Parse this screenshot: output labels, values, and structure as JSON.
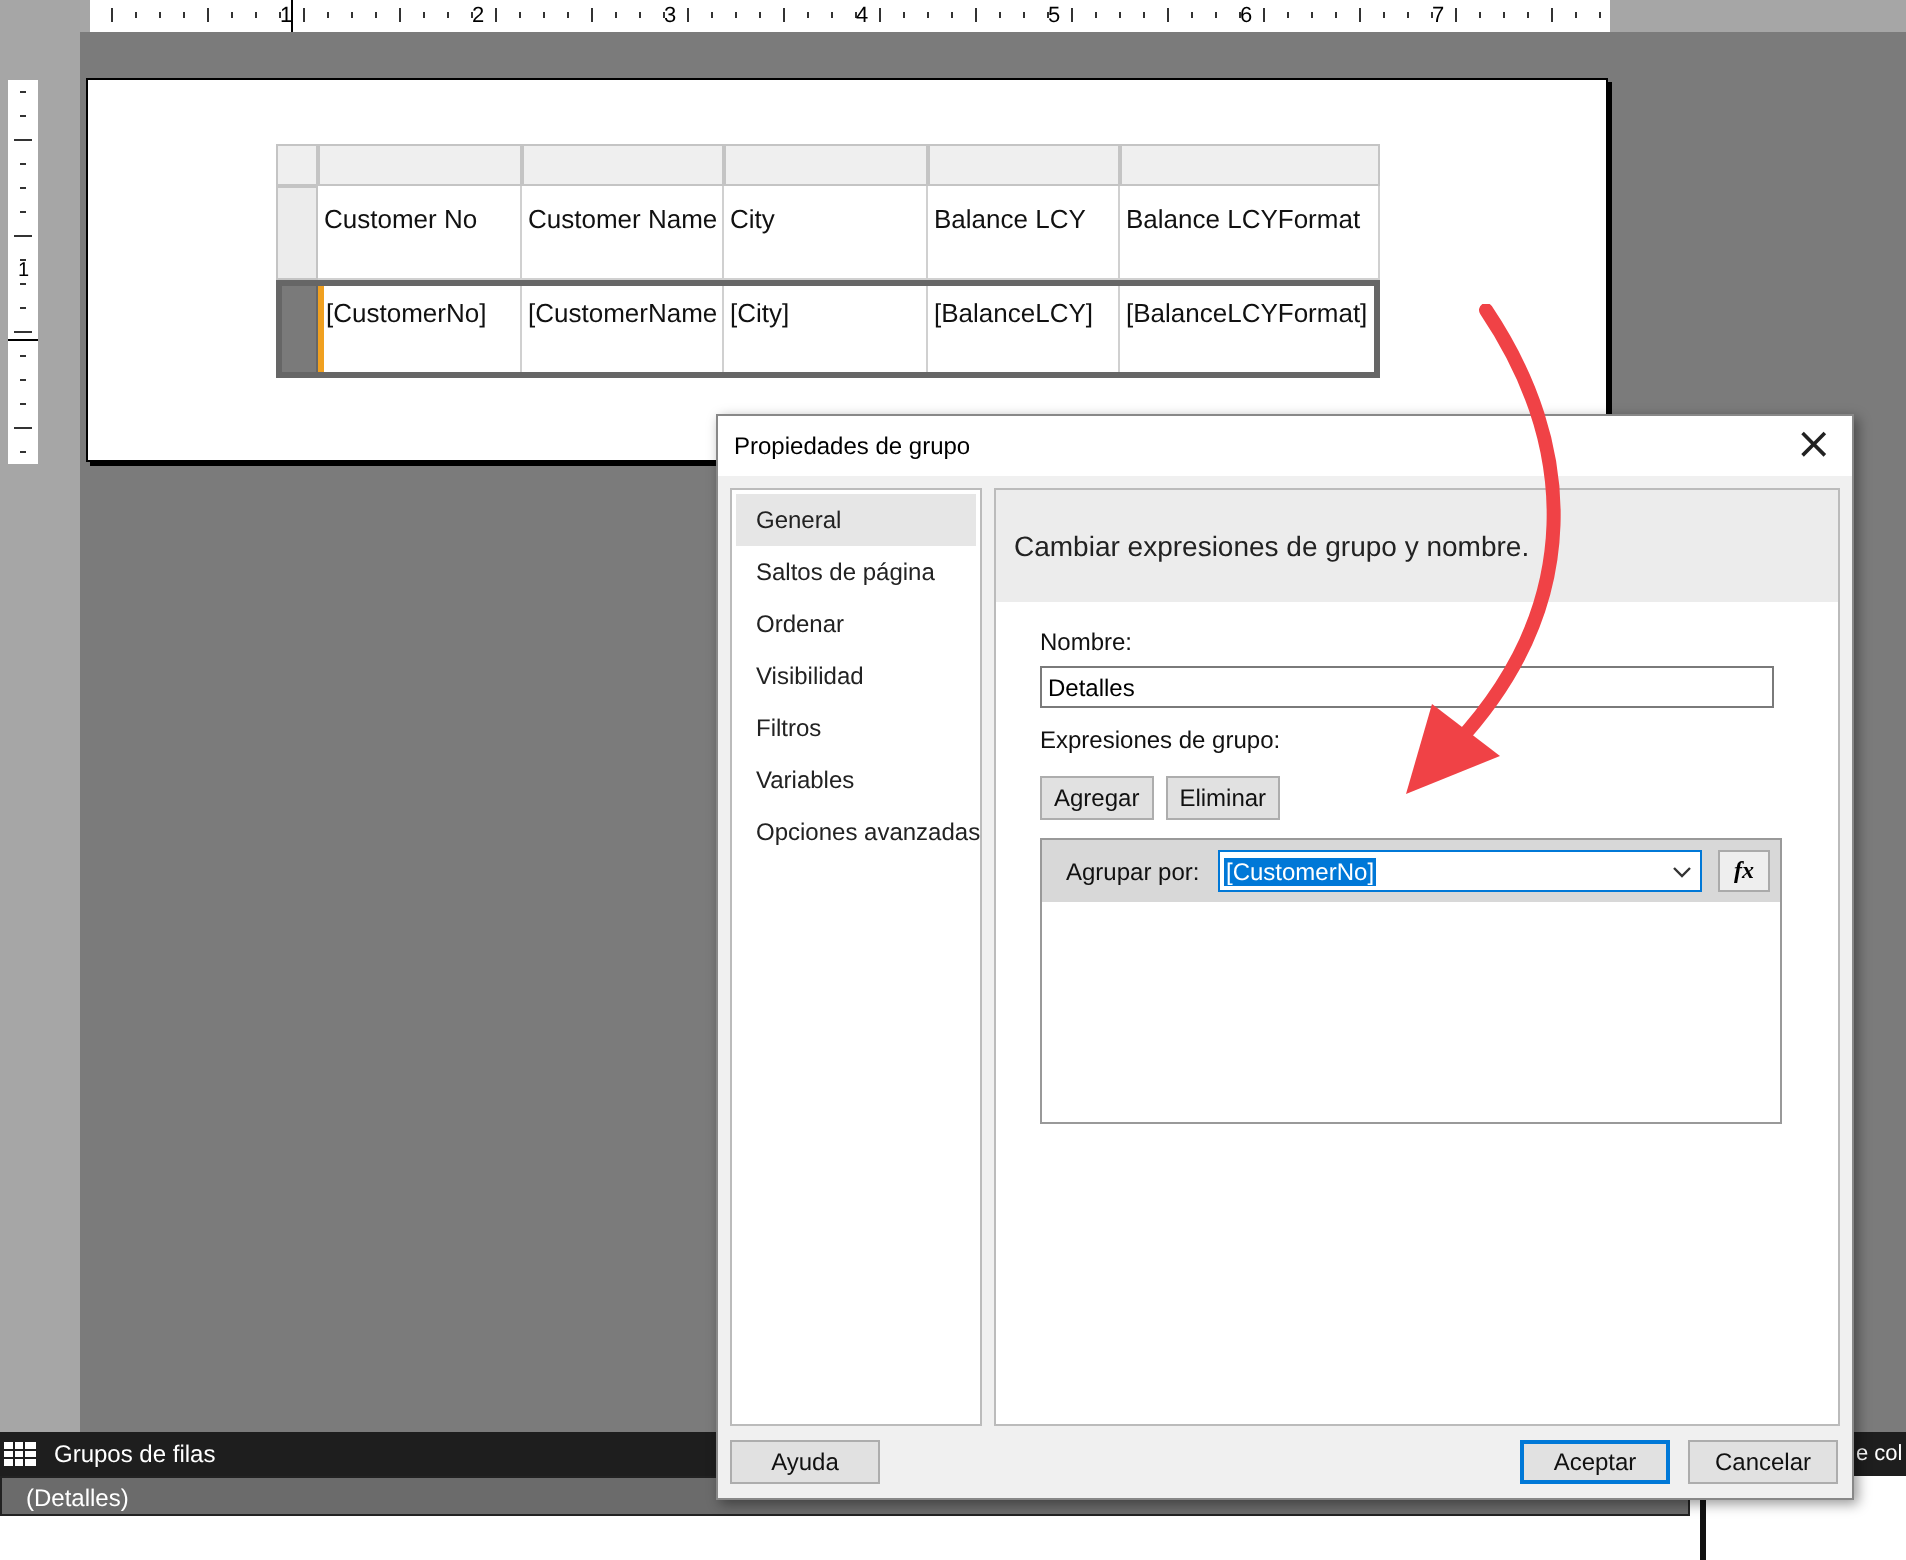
{
  "top_ruler": {
    "labels": [
      "1",
      "2",
      "3",
      "4",
      "5",
      "6",
      "7"
    ]
  },
  "left_ruler": {
    "labels": [
      "1"
    ]
  },
  "report_table": {
    "rows": [
      {
        "kind": "header",
        "selected": false,
        "cells": [
          "Customer No",
          "Customer Name",
          "City",
          "Balance LCY",
          "Balance LCYFormat"
        ]
      },
      {
        "kind": "detail",
        "selected": true,
        "cells": [
          "[CustomerNo]",
          "[CustomerName",
          "[City]",
          "[BalanceLCY]",
          "[BalanceLCYFormat]"
        ]
      }
    ]
  },
  "dialog": {
    "title": "Propiedades de grupo",
    "close": "×",
    "nav": [
      {
        "label": "General",
        "selected": true
      },
      {
        "label": "Saltos de página",
        "selected": false
      },
      {
        "label": "Ordenar",
        "selected": false
      },
      {
        "label": "Visibilidad",
        "selected": false
      },
      {
        "label": "Filtros",
        "selected": false
      },
      {
        "label": "Variables",
        "selected": false
      },
      {
        "label": "Opciones avanzadas",
        "selected": false
      }
    ],
    "heading": "Cambiar expresiones de grupo y nombre.",
    "name_label": "Nombre:",
    "name_value": "Detalles",
    "expressions_label": "Expresiones de grupo:",
    "buttons": [
      "Agregar",
      "Eliminar"
    ],
    "group_by": {
      "label": "Agrupar por:",
      "value": "[CustomerNo]",
      "fx": "fx"
    },
    "footer": {
      "help": "Ayuda",
      "ok": "Aceptar",
      "cancel": "Cancelar"
    }
  },
  "row_groups": {
    "title": "Grupos de filas",
    "items": [
      "(Detalles)"
    ]
  },
  "column_groups": {
    "title": "e col"
  }
}
